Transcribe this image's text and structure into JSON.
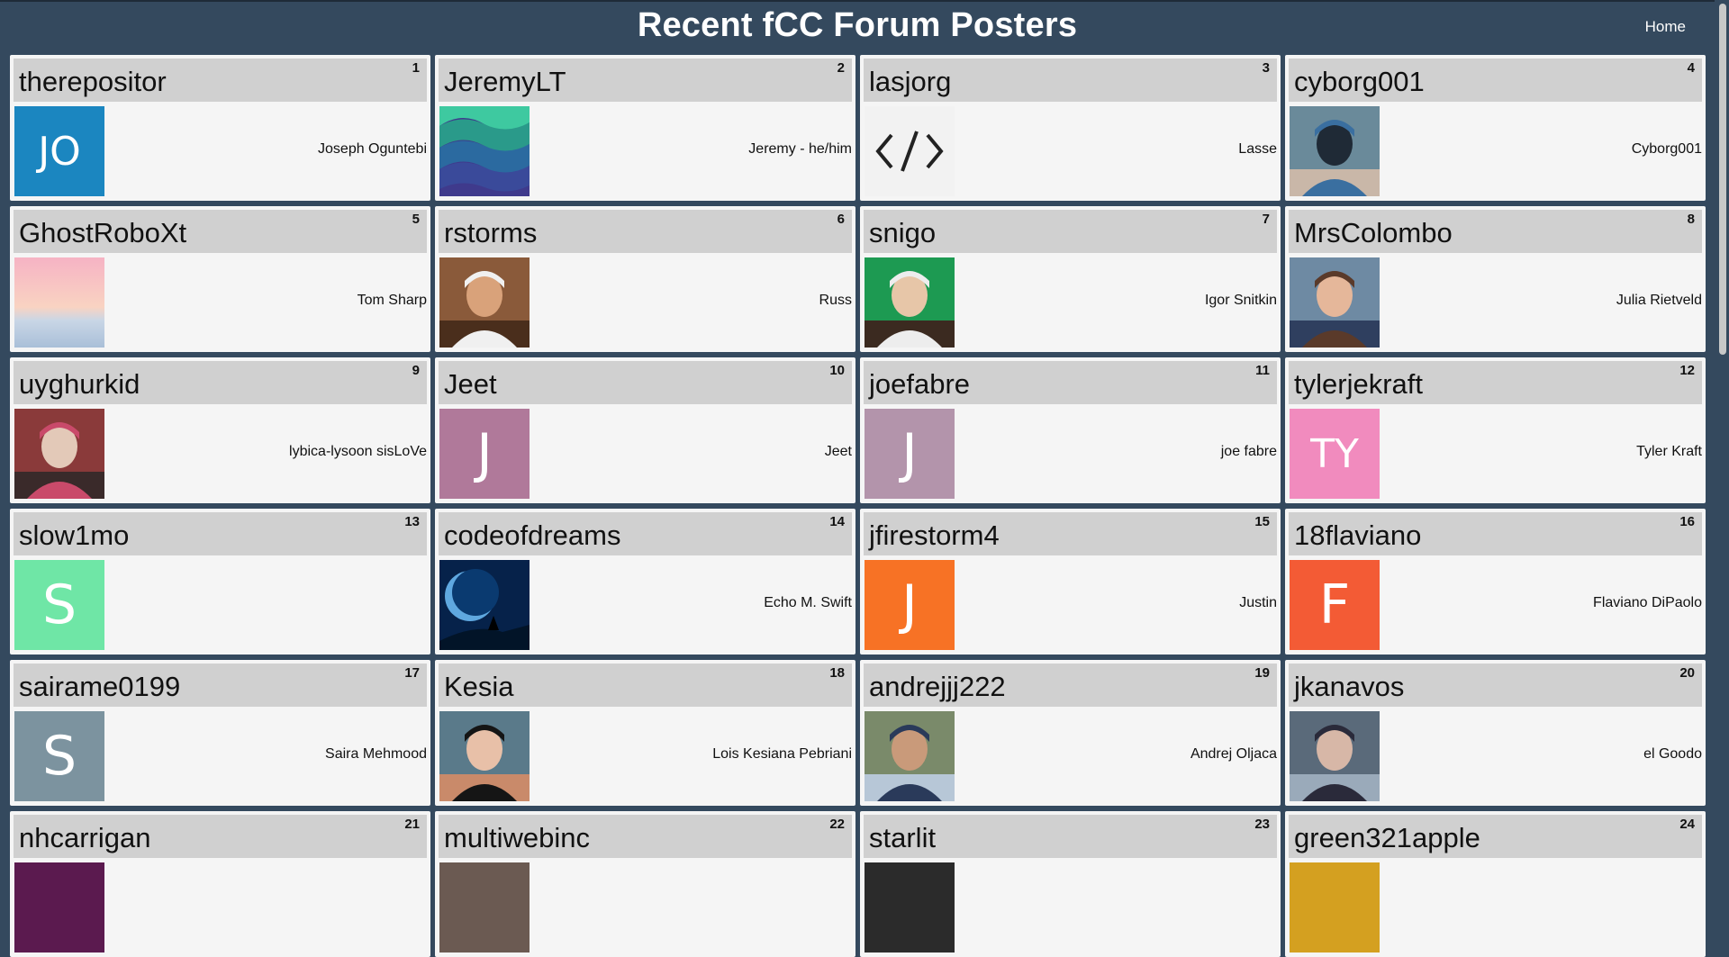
{
  "page": {
    "title": "Recent fCC Forum Posters",
    "home_link": "Home",
    "colors": {
      "background": "#34495e",
      "card": "#f5f5f5",
      "card_header": "#d0d0d0"
    }
  },
  "posters": [
    {
      "rank": "1",
      "username": "therepositor",
      "name": "Joseph Oguntebi",
      "avatar": {
        "type": "letter",
        "text": "JO",
        "color": "#1b86c0"
      }
    },
    {
      "rank": "2",
      "username": "JeremyLT",
      "name": "Jeremy - he/him",
      "avatar": {
        "type": "waves"
      }
    },
    {
      "rank": "3",
      "username": "lasjorg",
      "name": "Lasse",
      "avatar": {
        "type": "code"
      }
    },
    {
      "rank": "4",
      "username": "cyborg001",
      "name": "Cyborg001",
      "avatar": {
        "type": "photo",
        "desc": "graduation-photo"
      }
    },
    {
      "rank": "5",
      "username": "GhostRoboXt",
      "name": "Tom Sharp",
      "avatar": {
        "type": "sunset"
      }
    },
    {
      "rank": "6",
      "username": "rstorms",
      "name": "Russ",
      "avatar": {
        "type": "photo",
        "desc": "man-portrait"
      }
    },
    {
      "rank": "7",
      "username": "snigo",
      "name": "Igor Snitkin",
      "avatar": {
        "type": "photo",
        "desc": "man-green-background"
      }
    },
    {
      "rank": "8",
      "username": "MrsColombo",
      "name": "Julia Rietveld",
      "avatar": {
        "type": "photo",
        "desc": "woman-portrait"
      }
    },
    {
      "rank": "9",
      "username": "uyghurkid",
      "name": "lybica-lysoon sisLoVe",
      "avatar": {
        "type": "photo",
        "desc": "sisters-playhouse"
      }
    },
    {
      "rank": "10",
      "username": "Jeet",
      "name": "Jeet",
      "avatar": {
        "type": "letter",
        "text": "J",
        "color": "#b0799a"
      }
    },
    {
      "rank": "11",
      "username": "joefabre",
      "name": "joe fabre",
      "avatar": {
        "type": "letter",
        "text": "J",
        "color": "#b394ab"
      }
    },
    {
      "rank": "12",
      "username": "tylerjekraft",
      "name": "Tyler Kraft",
      "avatar": {
        "type": "letter",
        "text": "TY",
        "color": "#f18bbe"
      }
    },
    {
      "rank": "13",
      "username": "slow1mo",
      "name": "",
      "avatar": {
        "type": "letter",
        "text": "S",
        "color": "#6fe6a6"
      }
    },
    {
      "rank": "14",
      "username": "codeofdreams",
      "name": "Echo M. Swift",
      "avatar": {
        "type": "night"
      }
    },
    {
      "rank": "15",
      "username": "jfirestorm4",
      "name": "Justin",
      "avatar": {
        "type": "letter",
        "text": "J",
        "color": "#f77225"
      }
    },
    {
      "rank": "16",
      "username": "18flaviano",
      "name": "Flaviano DiPaolo",
      "avatar": {
        "type": "letter",
        "text": "F",
        "color": "#f35b35"
      }
    },
    {
      "rank": "17",
      "username": "sairame0199",
      "name": "Saira Mehmood",
      "avatar": {
        "type": "letter",
        "text": "S",
        "color": "#7c939f"
      }
    },
    {
      "rank": "18",
      "username": "Kesia",
      "name": "Lois Kesiana Pebriani",
      "avatar": {
        "type": "photo",
        "desc": "woman-dark-hair"
      }
    },
    {
      "rank": "19",
      "username": "andrejjj222",
      "name": "Andrej Oljaca",
      "avatar": {
        "type": "photo",
        "desc": "man-outdoor"
      }
    },
    {
      "rank": "20",
      "username": "jkanavos",
      "name": "el Goodo",
      "avatar": {
        "type": "photo",
        "desc": "father-child"
      }
    },
    {
      "rank": "21",
      "username": "nhcarrigan",
      "name": "",
      "avatar": {
        "type": "partial",
        "color": "#5b1a4f"
      }
    },
    {
      "rank": "22",
      "username": "multiwebinc",
      "name": "",
      "avatar": {
        "type": "partial",
        "color": "#6b5a52"
      }
    },
    {
      "rank": "23",
      "username": "starlit",
      "name": "",
      "avatar": {
        "type": "partial",
        "color": "#2b2b2b"
      }
    },
    {
      "rank": "24",
      "username": "green321apple",
      "name": "",
      "avatar": {
        "type": "partial",
        "color": "#d4a020"
      }
    }
  ]
}
